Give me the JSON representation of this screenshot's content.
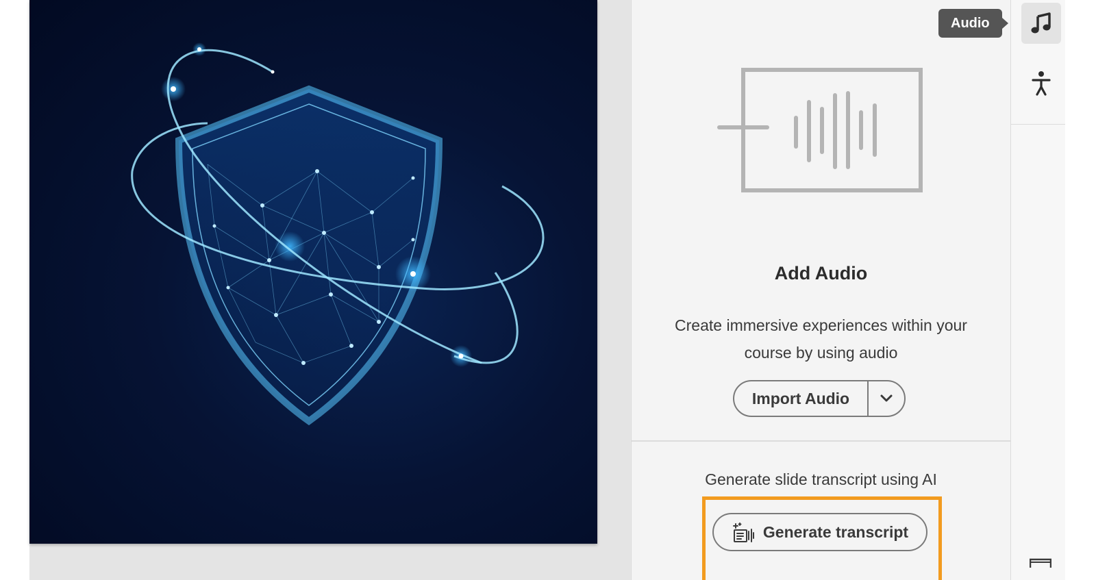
{
  "tooltip": {
    "text": "Audio"
  },
  "audio_panel": {
    "title": "Add Audio",
    "description": "Create immersive experiences within your course by using audio",
    "import_button_label": "Import Audio",
    "transcript_prompt": "Generate slide transcript using AI",
    "generate_button_label": "Generate transcript"
  },
  "rail": {
    "items": [
      {
        "icon": "music-note-icon",
        "active": true
      },
      {
        "icon": "accessibility-icon",
        "active": false
      }
    ]
  },
  "colors": {
    "highlight": "#f29b1f",
    "tooltip_bg": "#555555",
    "slide_bg": "#061334",
    "shield_glow": "#3fb7ff"
  }
}
